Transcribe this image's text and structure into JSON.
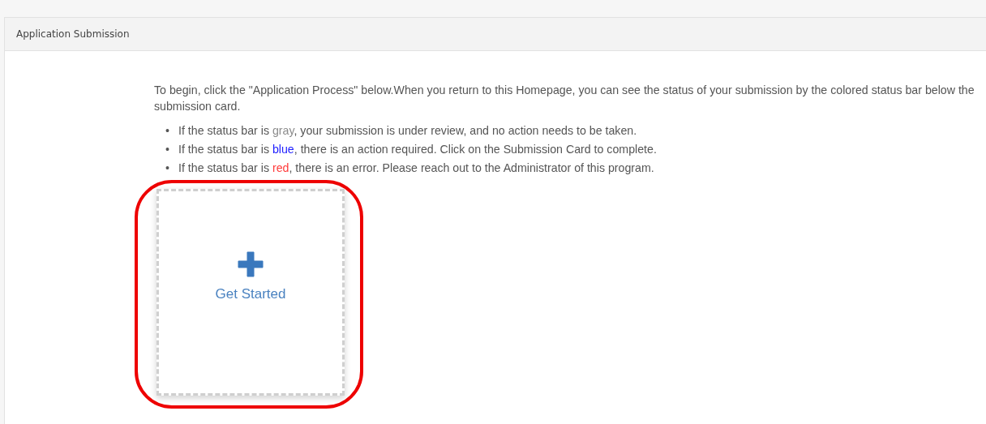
{
  "panel": {
    "title": "Application Submission"
  },
  "intro": "To begin, click the \"Application Process\" below.When you return to this Homepage, you can see the status of your submission by the colored status bar below the submission card.",
  "bullets": [
    {
      "marker": "•",
      "before": "If the status bar is ",
      "status": "gray",
      "color": "#8c8c8c",
      "after": ", your submission is under review, and no action needs to be taken."
    },
    {
      "marker": "•",
      "before": "If the status bar is ",
      "status": "blue",
      "color": "#1f1fff",
      "after": ", there is an action required. Click on the Submission Card to complete."
    },
    {
      "marker": "•",
      "before": "If the status bar is ",
      "status": "red",
      "color": "#ff3b3b",
      "after": ", there is an error. Please reach out to the Administrator of this program."
    }
  ],
  "card": {
    "label": "Get Started",
    "highlighted": true
  }
}
